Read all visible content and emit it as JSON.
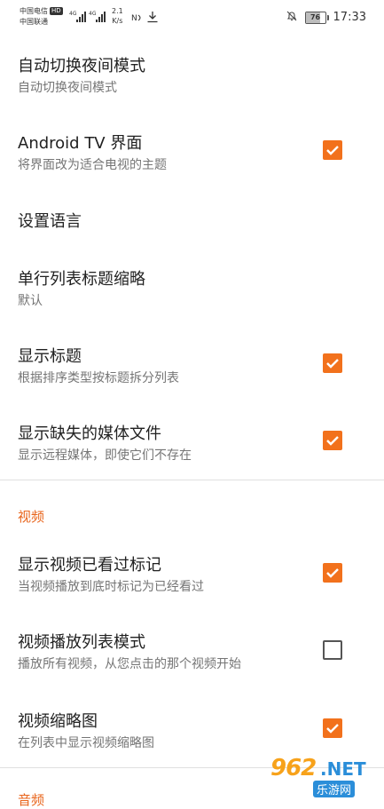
{
  "status_bar": {
    "carrier1": "中国电信",
    "carrier1_badge": "HD",
    "carrier2": "中国联通",
    "net_speed_value": "2.1",
    "net_speed_unit": "K/s",
    "battery": "76",
    "battery_level_percent": 76,
    "time": "17:33",
    "icons": [
      "signal-4g-icon",
      "signal-4g-icon",
      "nfc-icon",
      "download-icon",
      "mute-bell-icon",
      "battery-icon"
    ]
  },
  "settings": [
    {
      "title": "自动切换夜间模式",
      "summary": "自动切换夜间模式",
      "checkbox": null
    },
    {
      "title": "Android TV 界面",
      "summary": "将界面改为适合电视的主题",
      "checkbox": true
    },
    {
      "title": "设置语言",
      "summary": "",
      "checkbox": null
    },
    {
      "title": "单行列表标题缩略",
      "summary": "默认",
      "checkbox": null
    },
    {
      "title": "显示标题",
      "summary": "根据排序类型按标题拆分列表",
      "checkbox": true
    },
    {
      "title": "显示缺失的媒体文件",
      "summary": "显示远程媒体，即使它们不存在",
      "checkbox": true
    }
  ],
  "video_category": {
    "label": "视频",
    "items": [
      {
        "title": "显示视频已看过标记",
        "summary": "当视频播放到底时标记为已经看过",
        "checkbox": true
      },
      {
        "title": "视频播放列表模式",
        "summary": "播放所有视频，从您点击的那个视频开始",
        "checkbox": false
      },
      {
        "title": "视频缩略图",
        "summary": "在列表中显示视频缩略图",
        "checkbox": true
      }
    ]
  },
  "next_category": {
    "label": "音频"
  },
  "watermark": {
    "number": "962",
    "suffix": ".NET",
    "site": "乐游网"
  },
  "colors": {
    "accent": "#F2711C",
    "category": "#E8651C"
  }
}
